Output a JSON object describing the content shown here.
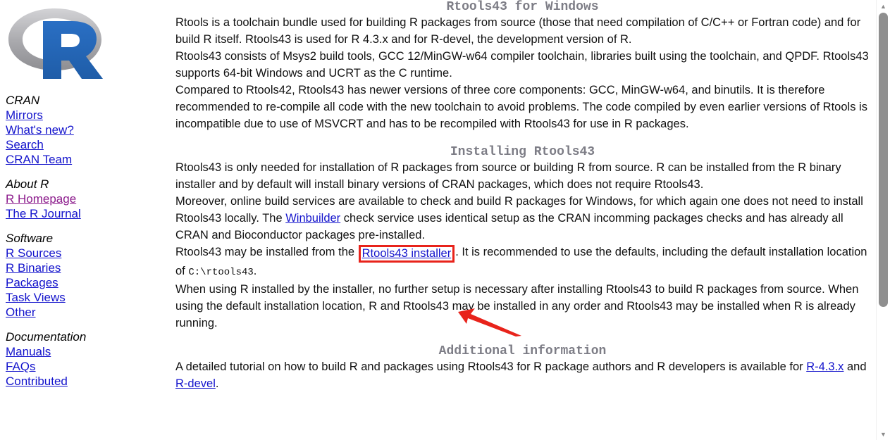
{
  "logo": {
    "letter": "R",
    "ring_color": "#9b9b9b",
    "letter_color": "#2266b8"
  },
  "sidebar": {
    "groups": [
      {
        "heading": "CRAN",
        "links": [
          {
            "label": "Mirrors",
            "visited": false
          },
          {
            "label": "What's new?",
            "visited": false
          },
          {
            "label": "Search",
            "visited": false
          },
          {
            "label": "CRAN Team",
            "visited": false
          }
        ]
      },
      {
        "heading": "About R",
        "links": [
          {
            "label": "R Homepage",
            "visited": true
          },
          {
            "label": "The R Journal",
            "visited": false
          }
        ]
      },
      {
        "heading": "Software",
        "links": [
          {
            "label": "R Sources",
            "visited": false
          },
          {
            "label": "R Binaries",
            "visited": false
          },
          {
            "label": "Packages",
            "visited": false
          },
          {
            "label": "Task Views",
            "visited": false
          },
          {
            "label": "Other",
            "visited": false
          }
        ]
      },
      {
        "heading": "Documentation",
        "links": [
          {
            "label": "Manuals",
            "visited": false
          },
          {
            "label": "FAQs",
            "visited": false
          },
          {
            "label": "Contributed",
            "visited": false
          }
        ]
      }
    ]
  },
  "main": {
    "title": "Rtools43 for Windows",
    "heading_installing": "Installing Rtools43",
    "heading_additional": "Additional information",
    "p1": "Rtools is a toolchain bundle used for building R packages from source (those that need compilation of C/C++ or Fortran code) and for build R itself. Rtools43 is used for R 4.3.x and for R-devel, the development version of R.",
    "p2": "Rtools43 consists of Msys2 build tools, GCC 12/MinGW-w64 compiler toolchain, libraries built using the toolchain, and QPDF. Rtools43 supports 64-bit Windows and UCRT as the C runtime.",
    "p3": "Compared to Rtools42, Rtools43 has newer versions of three core components: GCC, MinGW-w64, and binutils. It is therefore recommended to re-compile all code with the new toolchain to avoid problems. The code compiled by even earlier versions of Rtools is incompatible due to use of MSVCRT and has to be recompiled with Rtools43 for use in R packages.",
    "p4": "Rtools43 is only needed for installation of R packages from source or building R from source. R can be installed from the R binary installer and by default will install binary versions of CRAN packages, which does not require Rtools43.",
    "p5_a": "Moreover, online build services are available to check and build R packages for Windows, for which again one does not need to install Rtools43 locally. The ",
    "p5_link": "Winbuilder",
    "p5_b": " check service uses identical setup as the CRAN incomming packages checks and has already all CRAN and Bioconductor packages pre-installed.",
    "p6_a": "Rtools43 may be installed from the ",
    "p6_link": "Rtools43 installer",
    "p6_b": ". It is recommended to use the defaults, including the default installation location of ",
    "p6_code": "C:\\rtools43",
    "p6_c": ".",
    "p7": "When using R installed by the installer, no further setup is necessary after installing Rtools43 to build R packages from source. When using the default installation location, R and Rtools43 may be installed in any order and Rtools43 may be installed when R is already running.",
    "p8_a": "A detailed tutorial on how to build R and packages using Rtools43 for R package authors and R developers is available for ",
    "p8_link1": "R-4.3.x",
    "p8_b": " and ",
    "p8_link2": "R-devel",
    "p8_c": "."
  },
  "annotation": {
    "box_color": "#e8231b",
    "arrow_color": "#e8231b",
    "target_label": "Rtools43 installer"
  },
  "scrollbar": {
    "up_arrow": "▲",
    "down_arrow": "▼",
    "thumb_color": "#8f8f8f"
  }
}
